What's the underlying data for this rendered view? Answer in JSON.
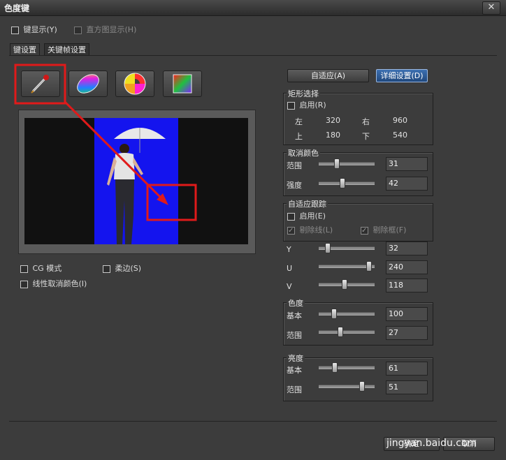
{
  "window": {
    "title": "色度键",
    "close_symbol": "✕"
  },
  "top_options": {
    "key_display": "键显示(Y)",
    "histogram_display": "直方图显示(H)"
  },
  "tabs": [
    {
      "label": "键设置"
    },
    {
      "label": "关键帧设置"
    }
  ],
  "tools": [
    {
      "name": "eyedropper-icon"
    },
    {
      "name": "color-ellipse-icon"
    },
    {
      "name": "color-wheel-icon"
    },
    {
      "name": "color-square-icon"
    }
  ],
  "preview_options": {
    "cg_mode": "CG 模式",
    "soft_edge": "柔边(S)",
    "linear_decolor": "线性取消颜色(I)"
  },
  "buttons": {
    "auto_adapt": "自适应(A)",
    "detail_settings": "详细设置(D)",
    "ok": "确定",
    "cancel": "取消"
  },
  "rect_select": {
    "title": "矩形选择",
    "enable": "启用(R)",
    "left_label": "左",
    "left_value": "320",
    "right_label": "右",
    "right_value": "960",
    "top_label": "上",
    "top_value": "180",
    "bottom_label": "下",
    "bottom_value": "540"
  },
  "decolor": {
    "title": "取消颜色",
    "range_label": "范围",
    "range_value": "31",
    "range_level": 0.3,
    "strength_label": "强度",
    "strength_value": "42",
    "strength_level": 0.42
  },
  "adaptive_tracking": {
    "title": "自适应跟踪",
    "enable": "启用(E)",
    "remove_line": "剔除线(L)",
    "remove_box": "剔除框(F)"
  },
  "yuv": [
    {
      "label": "Y",
      "value": "32",
      "level": 0.125
    },
    {
      "label": "U",
      "value": "240",
      "level": 0.94
    },
    {
      "label": "V",
      "value": "118",
      "level": 0.46
    }
  ],
  "chroma": {
    "title": "色度",
    "base_label": "基本",
    "base_value": "100",
    "base_level": 0.25,
    "range_label": "范围",
    "range_value": "27",
    "range_level": 0.38
  },
  "luma": {
    "title": "亮度",
    "base_label": "基本",
    "base_value": "61",
    "base_level": 0.27,
    "range_label": "范围",
    "range_value": "51",
    "range_level": 0.8
  },
  "watermark": "jingyan.baidu.com",
  "colors": {
    "annotation_red": "#e01a1a",
    "blue_screen": "#1010f0",
    "accent_blue": "#2a5ea8"
  }
}
